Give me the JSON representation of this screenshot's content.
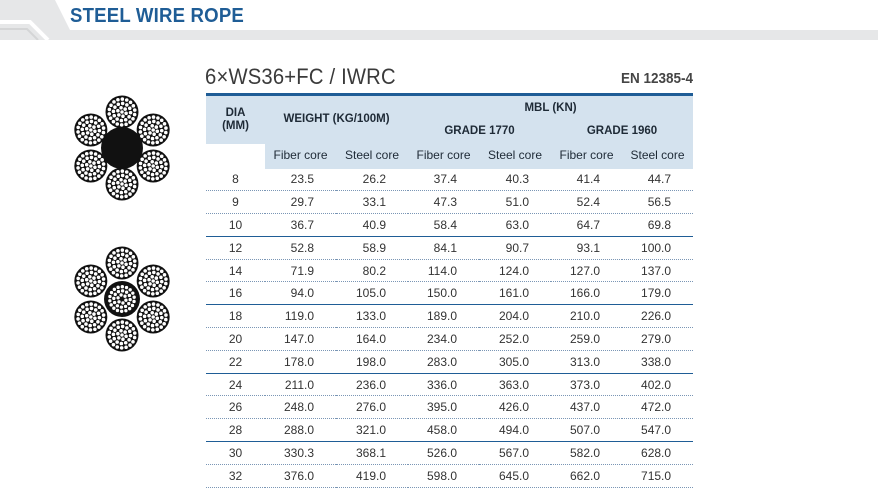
{
  "section_title": "STEEL WIRE ROPE",
  "product": {
    "title": "6×WS36+FC / IWRC",
    "standard": "EN 12385-4"
  },
  "table": {
    "headers": {
      "dia": "DIA",
      "dia_unit": "(MM)",
      "weight": "WEIGHT (KG/100M)",
      "mbl": "MBL (KN)",
      "grade1": "GRADE 1770",
      "grade2": "GRADE 1960",
      "fiber": "Fiber core",
      "steel": "Steel core"
    },
    "rows": [
      [
        "8",
        "23.5",
        "26.2",
        "37.4",
        "40.3",
        "41.4",
        "44.7"
      ],
      [
        "9",
        "29.7",
        "33.1",
        "47.3",
        "51.0",
        "52.4",
        "56.5"
      ],
      [
        "10",
        "36.7",
        "40.9",
        "58.4",
        "63.0",
        "64.7",
        "69.8"
      ],
      [
        "12",
        "52.8",
        "58.9",
        "84.1",
        "90.7",
        "93.1",
        "100.0"
      ],
      [
        "14",
        "71.9",
        "80.2",
        "114.0",
        "124.0",
        "127.0",
        "137.0"
      ],
      [
        "16",
        "94.0",
        "105.0",
        "150.0",
        "161.0",
        "166.0",
        "179.0"
      ],
      [
        "18",
        "119.0",
        "133.0",
        "189.0",
        "204.0",
        "210.0",
        "226.0"
      ],
      [
        "20",
        "147.0",
        "164.0",
        "234.0",
        "252.0",
        "259.0",
        "279.0"
      ],
      [
        "22",
        "178.0",
        "198.0",
        "283.0",
        "305.0",
        "313.0",
        "338.0"
      ],
      [
        "24",
        "211.0",
        "236.0",
        "336.0",
        "363.0",
        "373.0",
        "402.0"
      ],
      [
        "26",
        "248.0",
        "276.0",
        "395.0",
        "426.0",
        "437.0",
        "472.0"
      ],
      [
        "28",
        "288.0",
        "321.0",
        "458.0",
        "494.0",
        "507.0",
        "547.0"
      ],
      [
        "30",
        "330.3",
        "368.1",
        "526.0",
        "567.0",
        "582.0",
        "628.0"
      ],
      [
        "32",
        "376.0",
        "419.0",
        "598.0",
        "645.0",
        "662.0",
        "715.0"
      ]
    ]
  },
  "colors": {
    "brand_blue": "#1f5d96",
    "header_fill": "#d4e2ee",
    "banner_grey": "#e6e7e8"
  },
  "images": {
    "rope_top": "fiber-core-rope-cross-section",
    "rope_bottom": "steel-core-rope-cross-section"
  }
}
